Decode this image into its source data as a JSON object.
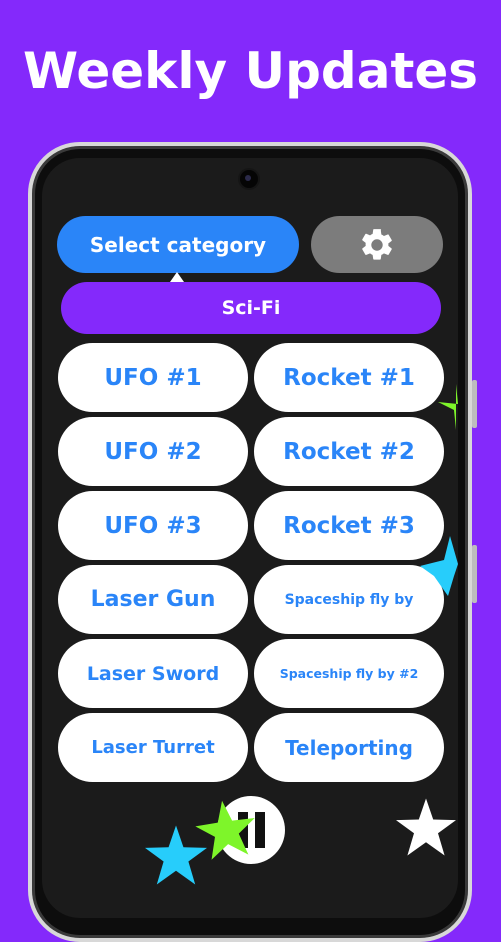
{
  "headline": "Weekly Updates",
  "toolbar": {
    "select_category_label": "Select category",
    "settings_icon": "gear-icon"
  },
  "category": {
    "selected": "Sci-Fi"
  },
  "sounds": [
    {
      "label": "UFO #1"
    },
    {
      "label": "Rocket #1"
    },
    {
      "label": "UFO #2"
    },
    {
      "label": "Rocket #2"
    },
    {
      "label": "UFO #3"
    },
    {
      "label": "Rocket #3"
    },
    {
      "label": "Laser Gun"
    },
    {
      "label": "Spaceship fly by"
    },
    {
      "label": "Laser Sword"
    },
    {
      "label": "Spaceship fly by #2"
    },
    {
      "label": "Laser Turret"
    },
    {
      "label": "Teleporting"
    }
  ],
  "controls": {
    "pause_icon": "pause-icon"
  },
  "colors": {
    "background": "#8429fb",
    "accent_blue": "#2a85f8",
    "settings_gray": "#7c7c7c",
    "screen": "#1b1b1b",
    "star_green": "#7ef52a",
    "star_cyan": "#27cdfb",
    "star_white": "#ffffff"
  }
}
